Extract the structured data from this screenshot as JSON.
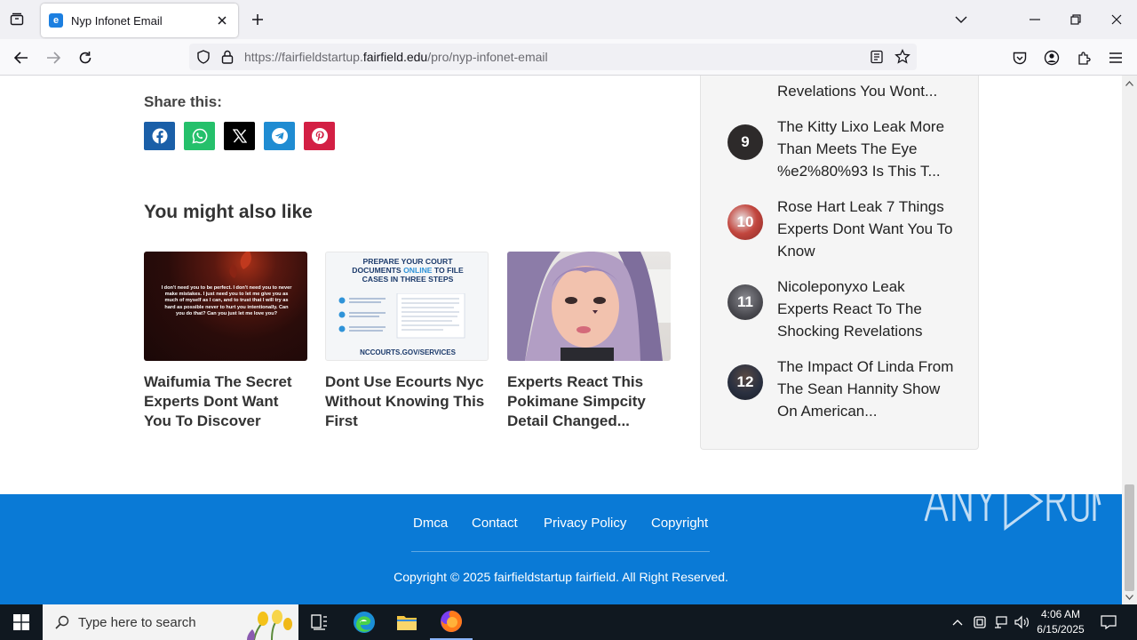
{
  "browser": {
    "tab_title": "Nyp Infonet Email",
    "url_prefix": "https://fairfieldstartup.",
    "url_domain": "fairfield.edu",
    "url_suffix": "/pro/nyp-infonet-email"
  },
  "share": {
    "label": "Share this:",
    "buttons": [
      {
        "name": "facebook",
        "color": "#1a5fa8"
      },
      {
        "name": "whatsapp",
        "color": "#25c06b"
      },
      {
        "name": "x",
        "color": "#000000"
      },
      {
        "name": "telegram",
        "color": "#1f8cd2"
      },
      {
        "name": "pinterest",
        "color": "#d31f44"
      }
    ]
  },
  "related": {
    "title": "You might also like",
    "cards": [
      {
        "title": "Waifumia The Secret Experts Dont Want You To Discover",
        "image_text": "I don't need you to be perfect. I don't need you to never make mistakes. I just need you to let me give you as much of myself as I can, and to trust that I will try as hard as possible never to hurt you intentionally. Can you do that? Can you just let me love you?"
      },
      {
        "title": "Dont Use Ecourts Nyc Without Knowing This First",
        "image_heading_1": "PREPARE YOUR COURT",
        "image_heading_2": "DOCUMENTS",
        "image_heading_online": "ONLINE",
        "image_heading_3": "TO FILE",
        "image_heading_4": "CASES IN THREE STEPS",
        "image_footer": "NCCOURTS.GOV/SERVICES"
      },
      {
        "title": "Experts React This Pokimane Simpcity Detail Changed..."
      }
    ]
  },
  "sidebar": {
    "items": [
      {
        "rank": "",
        "text": "Revelations You Wont..."
      },
      {
        "rank": "9",
        "text": "The Kitty Lixo Leak More Than Meets The Eye %e2%80%93 Is This T..."
      },
      {
        "rank": "10",
        "text": "Rose Hart Leak 7 Things Experts Dont Want You To Know"
      },
      {
        "rank": "11",
        "text": "Nicoleponyxo Leak Experts React To The Shocking Revelations"
      },
      {
        "rank": "12",
        "text": "The Impact Of Linda From The Sean Hannity Show On American..."
      }
    ]
  },
  "footer": {
    "links": [
      "Dmca",
      "Contact",
      "Privacy Policy",
      "Copyright"
    ],
    "copyright": "Copyright © 2025 fairfieldstartup fairfield. All Right Reserved."
  },
  "watermark": "ANY RUN",
  "taskbar": {
    "search_placeholder": "Type here to search",
    "time": "4:06 AM",
    "date": "6/15/2025"
  }
}
